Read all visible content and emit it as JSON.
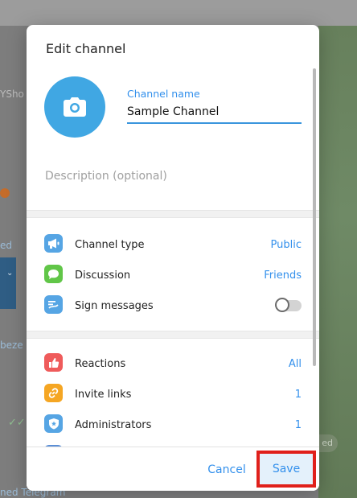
{
  "background": {
    "fragments": [
      "YSho",
      "ed",
      "beze",
      "ned Telegram",
      "ed"
    ]
  },
  "dialog": {
    "title": "Edit channel",
    "channel_name_label": "Channel name",
    "channel_name_value": "Sample Channel",
    "description_placeholder": "Description (optional)"
  },
  "settings": {
    "channel_type": {
      "label": "Channel type",
      "value": "Public",
      "icon": "megaphone-icon",
      "color": "#56a5e4"
    },
    "discussion": {
      "label": "Discussion",
      "value": "Friends",
      "icon": "chat-bubble-icon",
      "color": "#61c648"
    },
    "sign_messages": {
      "label": "Sign messages",
      "enabled": false,
      "icon": "signature-icon",
      "color": "#56a5e4"
    }
  },
  "admin": {
    "reactions": {
      "label": "Reactions",
      "value": "All",
      "icon": "thumbs-up-icon",
      "color": "#ef5b5b"
    },
    "invite_links": {
      "label": "Invite links",
      "value": "1",
      "icon": "link-icon",
      "color": "#f5a623"
    },
    "administrators": {
      "label": "Administrators",
      "value": "1",
      "icon": "shield-star-icon",
      "color": "#56a5e4"
    }
  },
  "footer": {
    "cancel_label": "Cancel",
    "save_label": "Save"
  },
  "colors": {
    "accent": "#3390ec",
    "avatar": "#40a7e3",
    "highlight": "#e0201b"
  }
}
